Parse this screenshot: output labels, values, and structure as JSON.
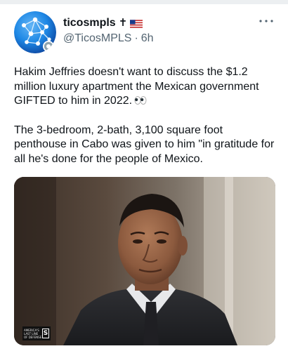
{
  "tweet": {
    "display_name": "ticosmpls",
    "name_badges": [
      "cross-icon",
      "us-flag-icon"
    ],
    "cross_glyph": "✝",
    "handle": "@TicosMPLS",
    "separator": "·",
    "time": "6h",
    "more_icon": "more-horizontal-icon",
    "body": [
      "Hakim Jeffries doesn't want to discuss the $1.2 million luxury apartment the Mexican government GIFTED to him in 2022.",
      "The 3-bedroom, 2-bath, 3,100 square foot penthouse in Cabo was given to him \"in gratitude for all he's done for the people of Mexico."
    ],
    "body_emoji_icon": "eyes-icon",
    "media": {
      "kind": "photo",
      "watermark_text": "AMERICA'S LAST LINE OF DEFENSE",
      "watermark_logo": "S"
    }
  },
  "colors": {
    "text_primary": "#0f1419",
    "text_secondary": "#536471",
    "avatar_blue": "#1565c0",
    "background": "#ffffff"
  }
}
